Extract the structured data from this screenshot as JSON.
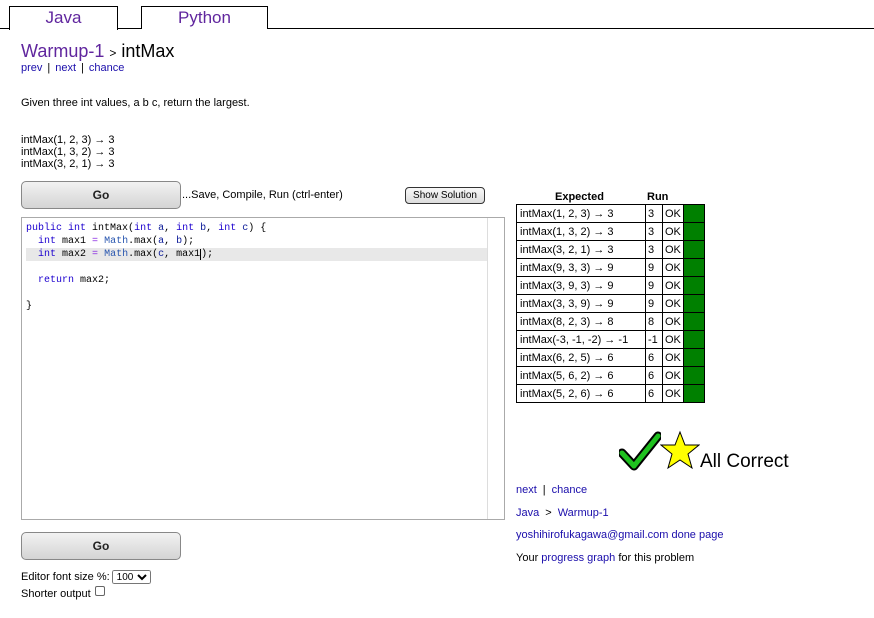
{
  "tabs": {
    "java": "Java",
    "python": "Python"
  },
  "header": {
    "section": "Warmup-1",
    "sep": ">",
    "problem": "intMax"
  },
  "nav": {
    "prev": "prev",
    "next": "next",
    "chance": "chance",
    "bar": "|"
  },
  "description": "Given three int values, a b c, return the largest.",
  "examples": [
    "intMax(1, 2, 3) → 3",
    "intMax(1, 3, 2) → 3",
    "intMax(3, 2, 1) → 3"
  ],
  "buttons": {
    "go": "Go",
    "save_hint": "...Save, Compile, Run (ctrl-enter)",
    "show_solution": "Show Solution"
  },
  "editor": {
    "lines": [
      "public int intMax(int a, int b, int c) {",
      "  int max1 = Math.max(a, b);",
      "  int max2 = Math.max(c, max1);",
      "",
      "  return max2;",
      "",
      "}"
    ]
  },
  "options": {
    "font_size_label": "Editor font size %:",
    "font_size_value": "100",
    "shorter_output": "Shorter output"
  },
  "results": {
    "headers": {
      "expected": "Expected",
      "run": "Run"
    },
    "rows": [
      {
        "expected": "intMax(1, 2, 3) → 3",
        "run": "3",
        "status": "OK"
      },
      {
        "expected": "intMax(1, 3, 2) → 3",
        "run": "3",
        "status": "OK"
      },
      {
        "expected": "intMax(3, 2, 1) → 3",
        "run": "3",
        "status": "OK"
      },
      {
        "expected": "intMax(9, 3, 3) → 9",
        "run": "9",
        "status": "OK"
      },
      {
        "expected": "intMax(3, 9, 3) → 9",
        "run": "9",
        "status": "OK"
      },
      {
        "expected": "intMax(3, 3, 9) → 9",
        "run": "9",
        "status": "OK"
      },
      {
        "expected": "intMax(8, 2, 3) → 8",
        "run": "8",
        "status": "OK"
      },
      {
        "expected": "intMax(-3, -1, -2) → -1",
        "run": "-1",
        "status": "OK"
      },
      {
        "expected": "intMax(6, 2, 5) → 6",
        "run": "6",
        "status": "OK"
      },
      {
        "expected": "intMax(5, 6, 2) → 6",
        "run": "6",
        "status": "OK"
      },
      {
        "expected": "intMax(5, 2, 6) → 6",
        "run": "6",
        "status": "OK"
      }
    ],
    "all_correct": "All Correct",
    "pass_color": "#008000"
  },
  "footer": {
    "next": "next",
    "chance": "chance",
    "bar": "|",
    "crumb_java": "Java",
    "crumb_sep": ">",
    "crumb_section": "Warmup-1",
    "done_page": "yoshihirofukagawa@gmail.com done page",
    "progress_prefix": "Your ",
    "progress_link": "progress graph",
    "progress_suffix": " for this problem"
  },
  "icons": {
    "check": "check-icon",
    "star": "star-icon"
  }
}
